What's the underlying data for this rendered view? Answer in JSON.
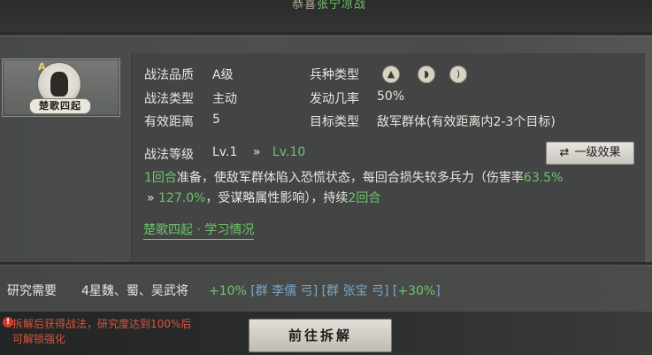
{
  "header": {
    "title_prefix": "恭喜",
    "title_highlight": "张宁凉战"
  },
  "skill": {
    "grade": "A",
    "name": "楚歌四起"
  },
  "attributes": [
    {
      "label": "战法品质",
      "value": "A级"
    },
    {
      "label": "兵种类型",
      "value": ""
    },
    {
      "label": "战法类型",
      "value": "主动"
    },
    {
      "label": "发动几率",
      "value": "50%"
    },
    {
      "label": "有效距离",
      "value": "5"
    },
    {
      "label": "目标类型",
      "value": "敌军群体(有效距离内2-3个目标)"
    }
  ],
  "troop_icons": [
    "cavalry-icon",
    "shield-icon",
    "bow-icon"
  ],
  "level": {
    "label": "战法等级",
    "current": "Lv.1",
    "arrow": "»",
    "max": "Lv.10"
  },
  "effect_button": {
    "icon": "swap-icon",
    "label": "一级效果"
  },
  "description": {
    "line1_green_a": "1回合",
    "line1_text_a": "准备，使敌军群体陷入恐慌状态，每回合损失较多兵力（伤害率",
    "line1_green_b": "63.5%",
    "line2_arrow": "»",
    "line2_green_a": "127.0%",
    "line2_text_a": "，受谋略属性影响），持续",
    "line2_green_b": "2回合"
  },
  "learn_link": "楚歌四起 · 学习情况",
  "research": {
    "label": "研究需要",
    "requirement": "4星魏、蜀、吴武将",
    "bonus1": "+10%",
    "bracket_open1": "[",
    "hero1": "群 李儒 弓",
    "bracket_close1": "]",
    "bracket_open2": "[",
    "hero2": "群 张宝 弓",
    "bracket_close2": "]",
    "bracket_open3": "[",
    "bonus2": "+30%",
    "bracket_close3": "]"
  },
  "warning": {
    "icon": "warning-icon",
    "text_line1": "拆解后获得战法，研究度达到100%后",
    "text_line2": "可解锁强化"
  },
  "dismantle_button": "前往拆解",
  "colors": {
    "accent_green": "#6fc36a",
    "hero_blue": "#7aa7c9",
    "warning_red": "#d9533f",
    "grade_gold": "#f0d26a"
  }
}
